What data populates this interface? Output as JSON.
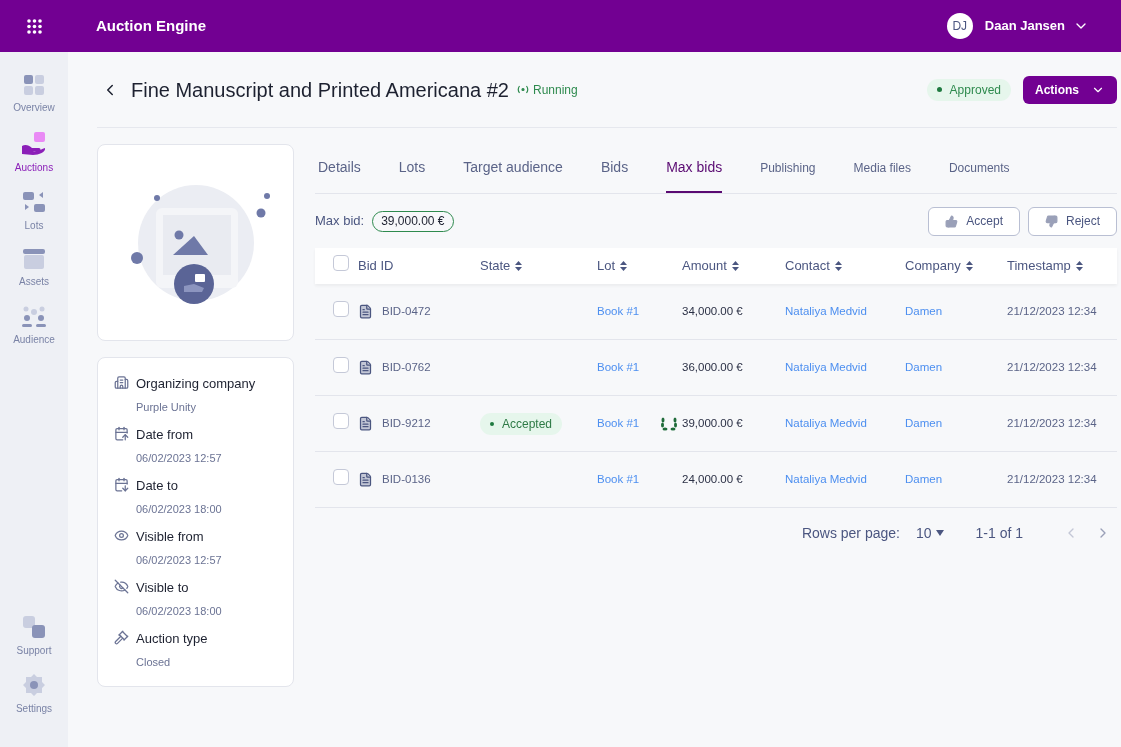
{
  "app": {
    "title": "Auction Engine",
    "user": {
      "initials": "DJ",
      "name": "Daan Jansen"
    }
  },
  "sidebar": {
    "items": [
      {
        "label": "Overview",
        "kind": "overview",
        "selected": false
      },
      {
        "label": "Auctions",
        "kind": "auctions",
        "selected": true
      },
      {
        "label": "Lots",
        "kind": "lots",
        "selected": false
      },
      {
        "label": "Assets",
        "kind": "assets",
        "selected": false
      },
      {
        "label": "Audience",
        "kind": "audience",
        "selected": false
      }
    ],
    "bottom_items": [
      {
        "label": "Support",
        "kind": "support",
        "selected": false
      },
      {
        "label": "Settings",
        "kind": "settings",
        "selected": false
      }
    ]
  },
  "header": {
    "title": "Fine Manuscript and Printed Americana #2",
    "status": "Running",
    "approval": "Approved",
    "actions_button": "Actions"
  },
  "details": [
    {
      "kind": "company",
      "label": "Organizing company",
      "value": "Purple Unity"
    },
    {
      "kind": "date-from",
      "label": "Date from",
      "value": "06/02/2023 12:57"
    },
    {
      "kind": "date-to",
      "label": "Date to",
      "value": "06/02/2023 18:00"
    },
    {
      "kind": "visible",
      "label": "Visible from",
      "value": "06/02/2023 12:57"
    },
    {
      "kind": "hidden",
      "label": "Visible to",
      "value": "06/02/2023 18:00"
    },
    {
      "kind": "gavel",
      "label": "Auction type",
      "value": "Closed"
    }
  ],
  "tabs": [
    {
      "label": "Details",
      "selected": false
    },
    {
      "label": "Lots",
      "selected": false
    },
    {
      "label": "Target audience",
      "selected": false
    },
    {
      "label": "Bids",
      "selected": false
    },
    {
      "label": "Max bids",
      "selected": true
    },
    {
      "label": "Publishing",
      "selected": false
    },
    {
      "label": "Media files",
      "selected": false
    },
    {
      "label": "Documents",
      "selected": false
    }
  ],
  "max_bid": {
    "label": "Max bid:",
    "value": "39,000.00 €"
  },
  "buttons": [
    {
      "label": "Accept",
      "kind": "accept"
    },
    {
      "label": "Reject",
      "kind": "reject"
    }
  ],
  "table": {
    "select_all_checked": false,
    "columns": [
      {
        "label": "Bid ID",
        "sortable": false
      },
      {
        "label": "State",
        "sortable": true
      },
      {
        "label": "Lot",
        "sortable": true
      },
      {
        "label": "Amount",
        "sortable": true
      },
      {
        "label": "Contact",
        "sortable": true
      },
      {
        "label": "Company",
        "sortable": true
      },
      {
        "label": "Timestamp",
        "sortable": true
      }
    ],
    "rows": [
      {
        "checked": false,
        "bid_id": "BID-0472",
        "lot": "Book #1",
        "amount": "34,000.00 €",
        "winner": false,
        "contact": "Nataliya Medvid",
        "company": "Damen",
        "timestamp": "21/12/2023 12:34"
      },
      {
        "checked": false,
        "bid_id": "BID-0762",
        "lot": "Book #1",
        "amount": "36,000.00 €",
        "winner": false,
        "contact": "Nataliya Medvid",
        "company": "Damen",
        "timestamp": "21/12/2023 12:34"
      },
      {
        "checked": false,
        "bid_id": "BID-9212",
        "state": "Accepted",
        "lot": "Book #1",
        "amount": "39,000.00 €",
        "winner": true,
        "contact": "Nataliya Medvid",
        "company": "Damen",
        "timestamp": "21/12/2023 12:34"
      },
      {
        "checked": false,
        "bid_id": "BID-0136",
        "lot": "Book #1",
        "amount": "24,000.00 €",
        "winner": false,
        "contact": "Nataliya Medvid",
        "company": "Damen",
        "timestamp": "21/12/2023 12:34"
      }
    ]
  },
  "pagination": {
    "rows_per_page_label": "Rows per page:",
    "rows_per_page": "10",
    "range": "1-1 of 1"
  }
}
